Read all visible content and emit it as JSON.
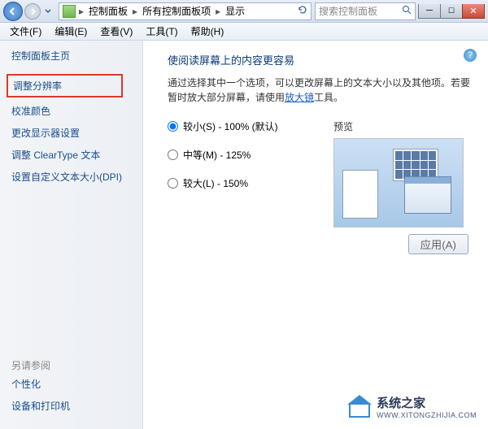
{
  "titlebar": {
    "breadcrumbs": [
      "控制面板",
      "所有控制面板项",
      "显示"
    ],
    "search_placeholder": "搜索控制面板"
  },
  "menu": {
    "file": "文件(F)",
    "edit": "编辑(E)",
    "view": "查看(V)",
    "tools": "工具(T)",
    "help": "帮助(H)"
  },
  "sidebar": {
    "home": "控制面板主页",
    "links": [
      "调整分辨率",
      "校准颜色",
      "更改显示器设置",
      "调整 ClearType 文本",
      "设置自定义文本大小(DPI)"
    ],
    "see_also_label": "另请参阅",
    "see_also": [
      "个性化",
      "设备和打印机"
    ]
  },
  "main": {
    "heading": "使阅读屏幕上的内容更容易",
    "desc_before": "通过选择其中一个选项，可以更改屏幕上的文本大小以及其他项。若要暂时放大部分屏幕，请使用",
    "desc_link": "放大镜",
    "desc_after": "工具。",
    "options": [
      {
        "label": "较小(S) - 100% (默认)",
        "checked": true
      },
      {
        "label": "中等(M) - 125%",
        "checked": false
      },
      {
        "label": "较大(L) - 150%",
        "checked": false
      }
    ],
    "preview_label": "预览",
    "apply_label": "应用(A)"
  },
  "watermark": {
    "brand": "系统之家",
    "url": "WWW.XITONGZHIJIA.COM"
  }
}
